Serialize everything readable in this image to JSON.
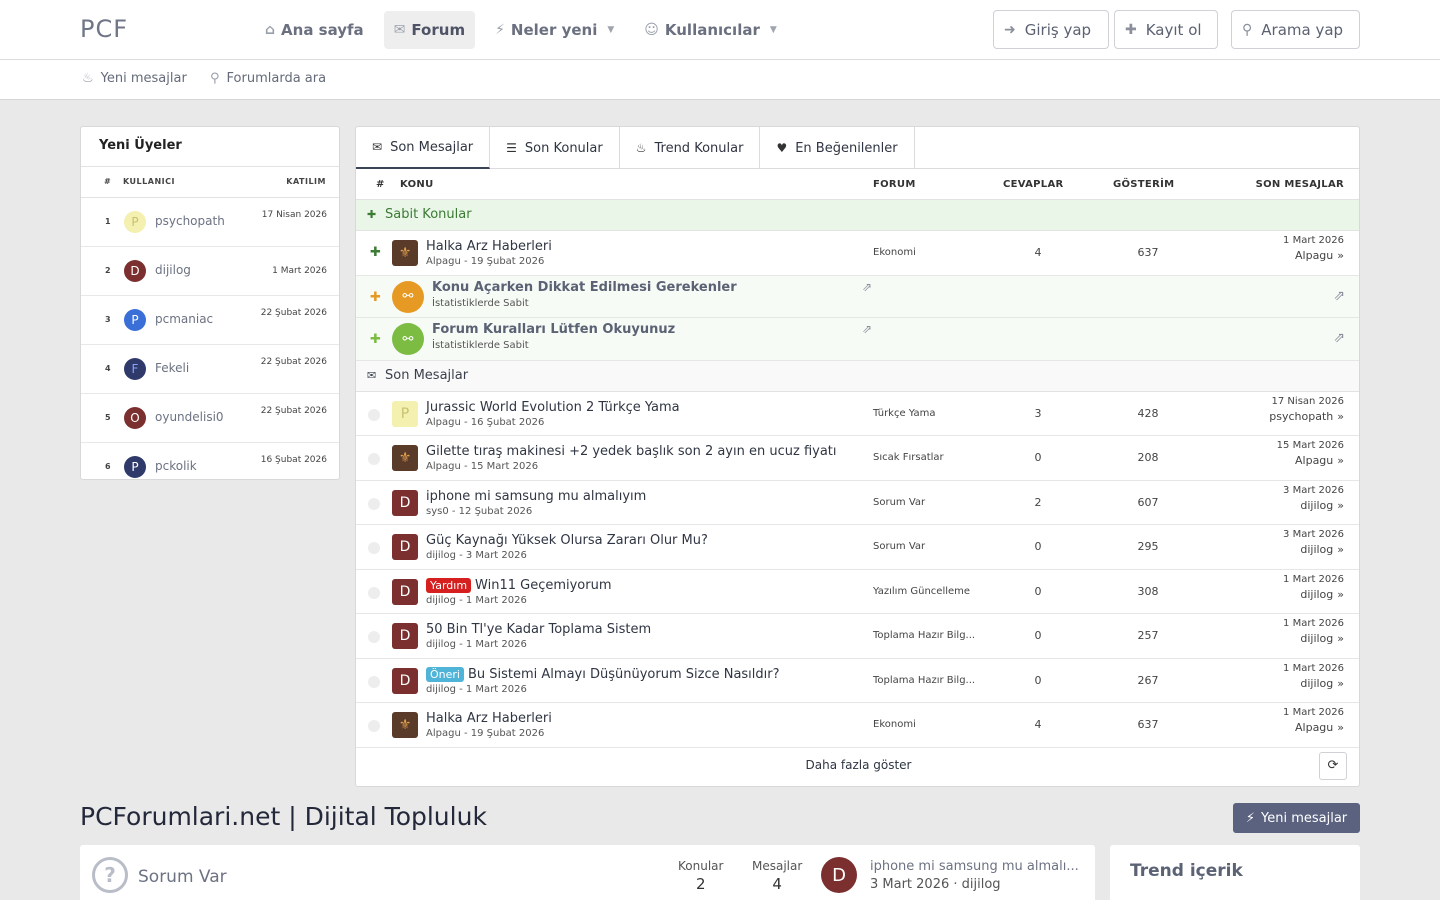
{
  "header": {
    "logo": "PCF",
    "nav": [
      {
        "label": "Ana sayfa",
        "icon": "home-icon",
        "glyph": "⌂"
      },
      {
        "label": "Forum",
        "icon": "comments-icon",
        "glyph": "✉"
      },
      {
        "label": "Neler yeni",
        "icon": "bolt-icon",
        "glyph": "⚡"
      },
      {
        "label": "Kullanıcılar",
        "icon": "users-icon",
        "glyph": "☺"
      }
    ],
    "login": "Giriş yap",
    "register": "Kayıt ol",
    "search": "Arama yap"
  },
  "subnav": {
    "new_posts": "Yeni mesajlar",
    "search_forums": "Forumlarda ara"
  },
  "members": {
    "title": "Yeni Üyeler",
    "col_num": "#",
    "col_user": "KULLANICI",
    "col_joined": "KATILIM",
    "rows": [
      {
        "num": "1",
        "letter": "P",
        "name": "psychopath",
        "date": "17 Nisan 2026",
        "color": "#f3f0b0",
        "fg": "#c8c270"
      },
      {
        "num": "2",
        "letter": "D",
        "name": "dijilog",
        "date": "1 Mart 2026",
        "color": "#7b2f2f",
        "fg": "#ffffff"
      },
      {
        "num": "3",
        "letter": "P",
        "name": "pcmaniac",
        "date": "22 Şubat 2026",
        "color": "#3a6fd8",
        "fg": "#ffffff"
      },
      {
        "num": "4",
        "letter": "F",
        "name": "Fekeli",
        "date": "22 Şubat 2026",
        "color": "#2f3a6a",
        "fg": "#8aa0ff"
      },
      {
        "num": "5",
        "letter": "O",
        "name": "oyundelisi0",
        "date": "22 Şubat 2026",
        "color": "#7b2f2f",
        "fg": "#ffffff"
      },
      {
        "num": "6",
        "letter": "P",
        "name": "pckolik",
        "date": "16 Şubat 2026",
        "color": "#2f3a6a",
        "fg": "#ffffff"
      }
    ]
  },
  "tabs": [
    "Son Mesajlar",
    "Son Konular",
    "Trend Konular",
    "En Beğenilenler"
  ],
  "table": {
    "col_num": "#",
    "col_topic": "KONU",
    "col_forum": "FORUM",
    "col_replies": "CEVAPLAR",
    "col_views": "GÖSTERİM",
    "col_last": "SON MESAJLAR",
    "sticky_label": "Sabit Konular",
    "recent_label": "Son Mesajlar",
    "sticky": [
      {
        "title": "Halka Arz Haberleri",
        "meta": "Alpagu - 19 Şubat 2026",
        "forum": "Ekonomi",
        "replies": "4",
        "views": "637",
        "last_date": "1 Mart 2026",
        "last_user": "Alpagu"
      }
    ],
    "links": [
      {
        "title": "Konu Açarken Dikkat Edilmesi Gerekenler",
        "meta": "İstatistiklerde Sabit",
        "color": "#e69a24"
      },
      {
        "title": "Forum Kuralları Lütfen Okuyunuz",
        "meta": "İstatistiklerde Sabit",
        "color": "#7cbc43"
      }
    ],
    "rows": [
      {
        "prefix": "",
        "prefix_color": "",
        "title": "Jurassic World Evolution 2 Türkçe Yama",
        "meta": "Alpagu - 16 Şubat 2026",
        "forum": "Türkçe Yama",
        "replies": "3",
        "views": "428",
        "last_date": "17 Nisan 2026",
        "last_user": "psychopath",
        "av": "P",
        "av_color": "#f3f0b0",
        "av_fg": "#c8c270"
      },
      {
        "prefix": "",
        "prefix_color": "",
        "title": "Gilette tıraş makinesi +2 yedek başlık son 2 ayın en ucuz fiyatı",
        "meta": "Alpagu - 15 Mart 2026",
        "forum": "Sıcak Fırsatlar",
        "replies": "0",
        "views": "208",
        "last_date": "15 Mart 2026",
        "last_user": "Alpagu",
        "av": "img",
        "av_color": "#5a3a28",
        "av_fg": "#e0a050"
      },
      {
        "prefix": "",
        "prefix_color": "",
        "title": "iphone mi samsung mu almalıyım",
        "meta": "sys0 - 12 Şubat 2026",
        "forum": "Sorum Var",
        "replies": "2",
        "views": "607",
        "last_date": "3 Mart 2026",
        "last_user": "dijilog",
        "av": "D",
        "av_color": "#7b2f2f",
        "av_fg": "#ffffff"
      },
      {
        "prefix": "",
        "prefix_color": "",
        "title": "Güç Kaynağı Yüksek Olursa Zararı Olur Mu?",
        "meta": "dijilog - 3 Mart 2026",
        "forum": "Sorum Var",
        "replies": "0",
        "views": "295",
        "last_date": "3 Mart 2026",
        "last_user": "dijilog",
        "av": "D",
        "av_color": "#7b2f2f",
        "av_fg": "#ffffff"
      },
      {
        "prefix": "Yardım",
        "prefix_color": "#d61f1f",
        "title": "Win11 Geçemiyorum",
        "meta": "dijilog - 1 Mart 2026",
        "forum": "Yazılım Güncelleme",
        "replies": "0",
        "views": "308",
        "last_date": "1 Mart 2026",
        "last_user": "dijilog",
        "av": "D",
        "av_color": "#7b2f2f",
        "av_fg": "#ffffff"
      },
      {
        "prefix": "",
        "prefix_color": "",
        "title": "50 Bin Tl'ye Kadar Toplama Sistem",
        "meta": "dijilog - 1 Mart 2026",
        "forum": "Toplama Hazır Bilg...",
        "replies": "0",
        "views": "257",
        "last_date": "1 Mart 2026",
        "last_user": "dijilog",
        "av": "D",
        "av_color": "#7b2f2f",
        "av_fg": "#ffffff"
      },
      {
        "prefix": "Öneri",
        "prefix_color": "#4fb4d8",
        "title": "Bu Sistemi Almayı Düşünüyorum Sizce Nasıldır?",
        "meta": "dijilog - 1 Mart 2026",
        "forum": "Toplama Hazır Bilg...",
        "replies": "0",
        "views": "267",
        "last_date": "1 Mart 2026",
        "last_user": "dijilog",
        "av": "D",
        "av_color": "#7b2f2f",
        "av_fg": "#ffffff"
      },
      {
        "prefix": "",
        "prefix_color": "",
        "title": "Halka Arz Haberleri",
        "meta": "Alpagu - 19 Şubat 2026",
        "forum": "Ekonomi",
        "replies": "4",
        "views": "637",
        "last_date": "1 Mart 2026",
        "last_user": "Alpagu",
        "av": "img",
        "av_color": "#5a3a28",
        "av_fg": "#e0a050"
      }
    ],
    "more": "Daha fazla göster"
  },
  "site_title": "PCForumlari.net | Dijital Topluluk",
  "new_posts_button": "Yeni mesajlar",
  "node": {
    "name": "Sorum Var",
    "topics_label": "Konular",
    "topics": "2",
    "posts_label": "Mesajlar",
    "posts": "4",
    "last_avatar": "D",
    "last_title": "iphone mi samsung mu almalı...",
    "last_meta": "3 Mart 2026 · dijilog"
  },
  "trend_title": "Trend içerik"
}
